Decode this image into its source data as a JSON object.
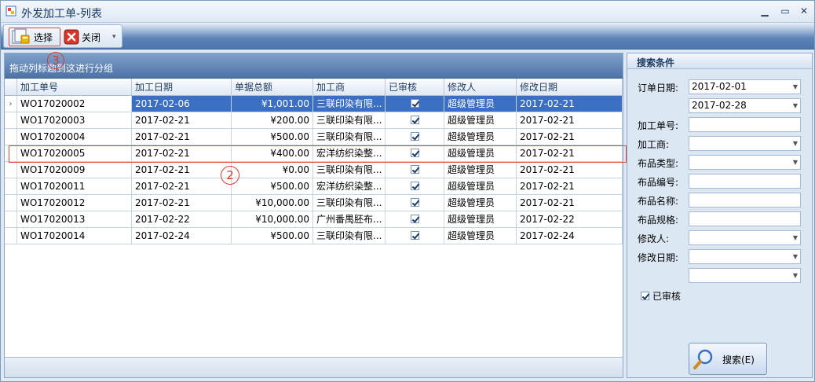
{
  "window": {
    "title": "外发加工单-列表",
    "minimize": "▁",
    "maximize": "▭",
    "close": "✕"
  },
  "toolbar": {
    "select_label": "选择",
    "close_label": "关闭"
  },
  "annotations": {
    "marker_2": "2",
    "marker_3": "3"
  },
  "grid": {
    "group_hint": "拖动列标题到这进行分组",
    "columns": [
      "加工单号",
      "加工日期",
      "单据总额",
      "加工商",
      "已审核",
      "修改人",
      "修改日期"
    ],
    "rows": [
      {
        "id": "WO17020002",
        "date": "2017-02-06",
        "total": "¥1,001.00",
        "vendor": "三联印染有限...",
        "audited": true,
        "modifier": "超级管理员",
        "mod_date": "2017-02-21",
        "selected": true
      },
      {
        "id": "WO17020003",
        "date": "2017-02-21",
        "total": "¥200.00",
        "vendor": "三联印染有限...",
        "audited": true,
        "modifier": "超级管理员",
        "mod_date": "2017-02-21"
      },
      {
        "id": "WO17020004",
        "date": "2017-02-21",
        "total": "¥500.00",
        "vendor": "三联印染有限...",
        "audited": true,
        "modifier": "超级管理员",
        "mod_date": "2017-02-21"
      },
      {
        "id": "WO17020005",
        "date": "2017-02-21",
        "total": "¥400.00",
        "vendor": "宏洋纺织染整...",
        "audited": true,
        "modifier": "超级管理员",
        "mod_date": "2017-02-21"
      },
      {
        "id": "WO17020009",
        "date": "2017-02-21",
        "total": "¥0.00",
        "vendor": "三联印染有限...",
        "audited": true,
        "modifier": "超级管理员",
        "mod_date": "2017-02-21"
      },
      {
        "id": "WO17020011",
        "date": "2017-02-21",
        "total": "¥500.00",
        "vendor": "宏洋纺织染整...",
        "audited": true,
        "modifier": "超级管理员",
        "mod_date": "2017-02-21"
      },
      {
        "id": "WO17020012",
        "date": "2017-02-21",
        "total": "¥10,000.00",
        "vendor": "三联印染有限...",
        "audited": true,
        "modifier": "超级管理员",
        "mod_date": "2017-02-21"
      },
      {
        "id": "WO17020013",
        "date": "2017-02-22",
        "total": "¥10,000.00",
        "vendor": "广州番禺胚布...",
        "audited": true,
        "modifier": "超级管理员",
        "mod_date": "2017-02-22"
      },
      {
        "id": "WO17020014",
        "date": "2017-02-24",
        "total": "¥500.00",
        "vendor": "三联印染有限...",
        "audited": true,
        "modifier": "超级管理员",
        "mod_date": "2017-02-24"
      }
    ]
  },
  "search": {
    "title": "搜索条件",
    "order_date_label": "订单日期:",
    "order_date_from": "2017-02-01",
    "order_date_to": "2017-02-28",
    "order_no_label": "加工单号:",
    "vendor_label": "加工商:",
    "fabric_type_label": "布品类型:",
    "fabric_code_label": "布品编号:",
    "fabric_name_label": "布品名称:",
    "fabric_spec_label": "布品规格:",
    "modifier_label": "修改人:",
    "mod_date_label": "修改日期:",
    "audited_label": "已审核",
    "audited_checked": true,
    "search_button": "搜索(E)"
  }
}
